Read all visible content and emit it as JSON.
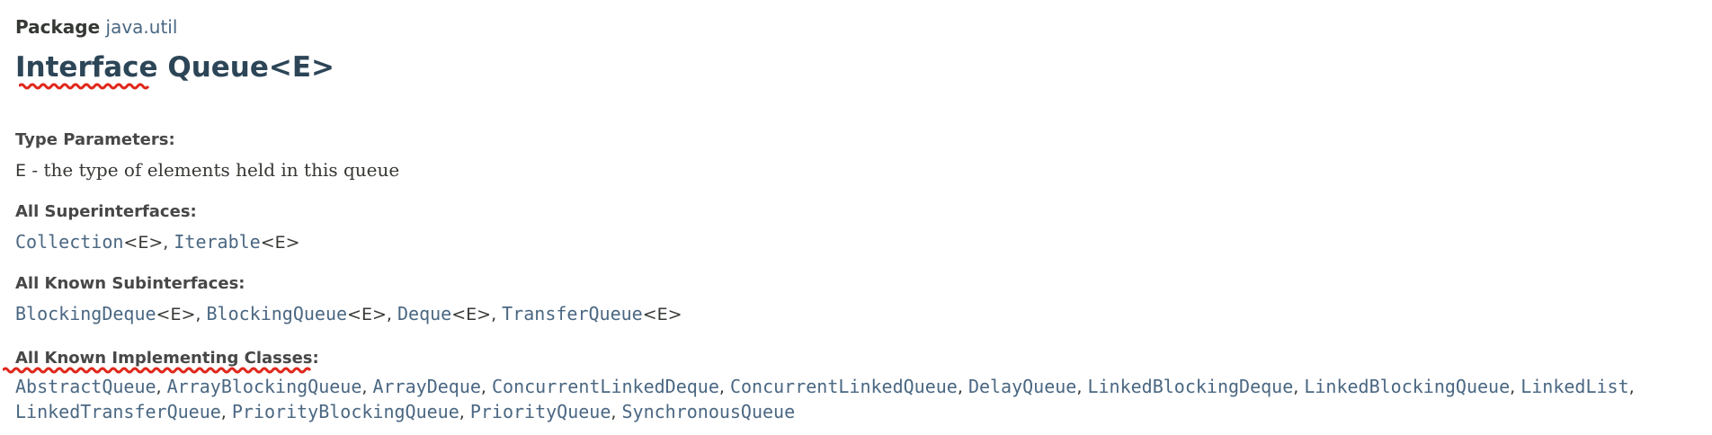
{
  "top_fragment": "´",
  "package": {
    "label": "Package",
    "name": "java.util"
  },
  "title": {
    "prefix": "Interface",
    "name": "Queue<E>"
  },
  "type_parameters": {
    "label": "Type Parameters:",
    "param": "E",
    "description": " - the type of elements held in this queue"
  },
  "superinterfaces": {
    "label": "All Superinterfaces:",
    "items": [
      "Collection",
      "Iterable"
    ],
    "type_suffix": "<E>",
    "separator": ", "
  },
  "subinterfaces": {
    "label": "All Known Subinterfaces:",
    "items": [
      "BlockingDeque",
      "BlockingQueue",
      "Deque",
      "TransferQueue"
    ],
    "type_suffix": "<E>",
    "separator": ", "
  },
  "implementing_classes": {
    "label": "All Known Implementing Classes:",
    "line1": [
      "AbstractQueue",
      "ArrayBlockingQueue",
      "ArrayDeque",
      "ConcurrentLinkedDeque",
      "ConcurrentLinkedQueue",
      "DelayQueue",
      "LinkedBlockingDeque",
      "LinkedBlockingQueue",
      "LinkedList"
    ],
    "line2": [
      "LinkedTransferQueue",
      "PriorityBlockingQueue",
      "PriorityQueue",
      "SynchronousQueue"
    ],
    "separator": ", ",
    "line_end": ","
  },
  "colors": {
    "link": "#4a6782",
    "title": "#2c4557",
    "text": "#353833",
    "label": "#474747",
    "annotation_underline": "#e0271b"
  }
}
